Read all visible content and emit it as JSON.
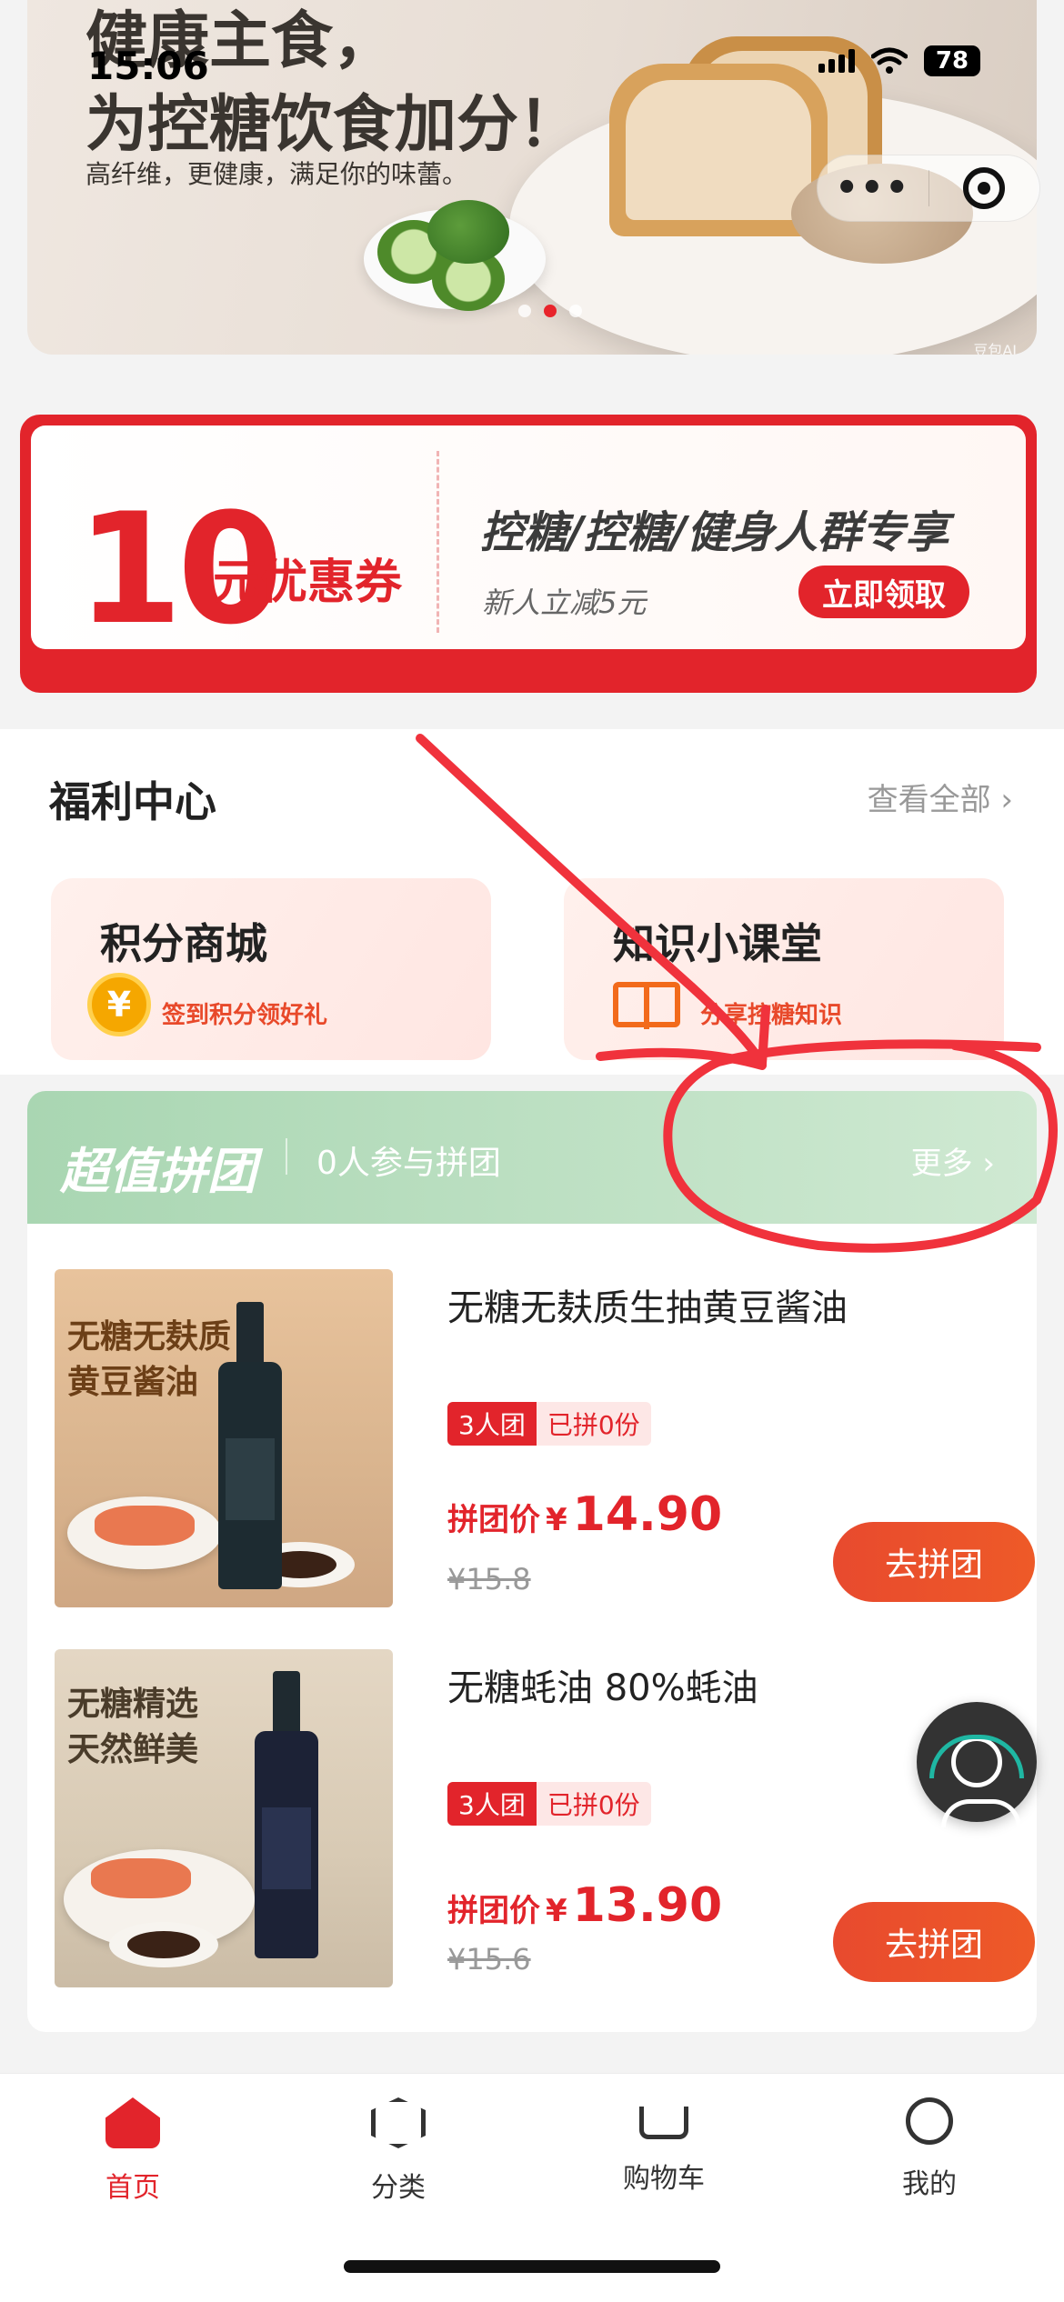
{
  "status_bar": {
    "time": "15:06",
    "battery": "78"
  },
  "banner": {
    "title": "健康主食，\n为控糖饮食加分！",
    "subtitle": "高纤维，更健康，满足你的味蕾。",
    "watermark": "豆包AI"
  },
  "capsule": {
    "more_label": "•••"
  },
  "coupon": {
    "amount": "10",
    "unit": "元优惠券",
    "title": "控糖/控糖/健身人群专享",
    "subtitle": "新人立减5元",
    "button": "立即领取"
  },
  "welfare": {
    "title": "福利中心",
    "view_all": "查看全部 ›",
    "cards": [
      {
        "title": "积分商城",
        "subtitle": "签到积分领好礼",
        "icon": "coin-icon",
        "coin_symbol": "¥"
      },
      {
        "title": "知识小课堂",
        "subtitle": "分享控糖知识",
        "icon": "book-icon"
      }
    ]
  },
  "group_buy": {
    "title": "超值拼团",
    "count": "0人参与拼团",
    "more": "更多 ›",
    "products": [
      {
        "name": "无糖无麸质生抽黄豆酱油",
        "image_caption": "无糖无麸质\n黄豆酱油",
        "tag_size": "3人团",
        "tag_joined": "已拼0份",
        "price_label": "拼团价",
        "currency": "¥",
        "price": "14.90",
        "original_price": "¥15.8",
        "button": "去拼团"
      },
      {
        "name": "无糖蚝油 80%蚝油",
        "image_caption": "无糖精选\n天然鲜美",
        "tag_size": "3人团",
        "tag_joined": "已拼0份",
        "price_label": "拼团价",
        "currency": "¥",
        "price": "13.90",
        "original_price": "¥15.6",
        "button": "去拼团"
      }
    ]
  },
  "tabbar": {
    "items": [
      {
        "label": "首页",
        "icon": "home-icon",
        "active": true
      },
      {
        "label": "分类",
        "icon": "category-icon",
        "active": false
      },
      {
        "label": "购物车",
        "icon": "cart-icon",
        "active": false
      },
      {
        "label": "我的",
        "icon": "profile-icon",
        "active": false
      }
    ]
  },
  "colors": {
    "accent": "#e2242b",
    "group_header": "#a9d6b2",
    "button": "#ee5a28"
  }
}
